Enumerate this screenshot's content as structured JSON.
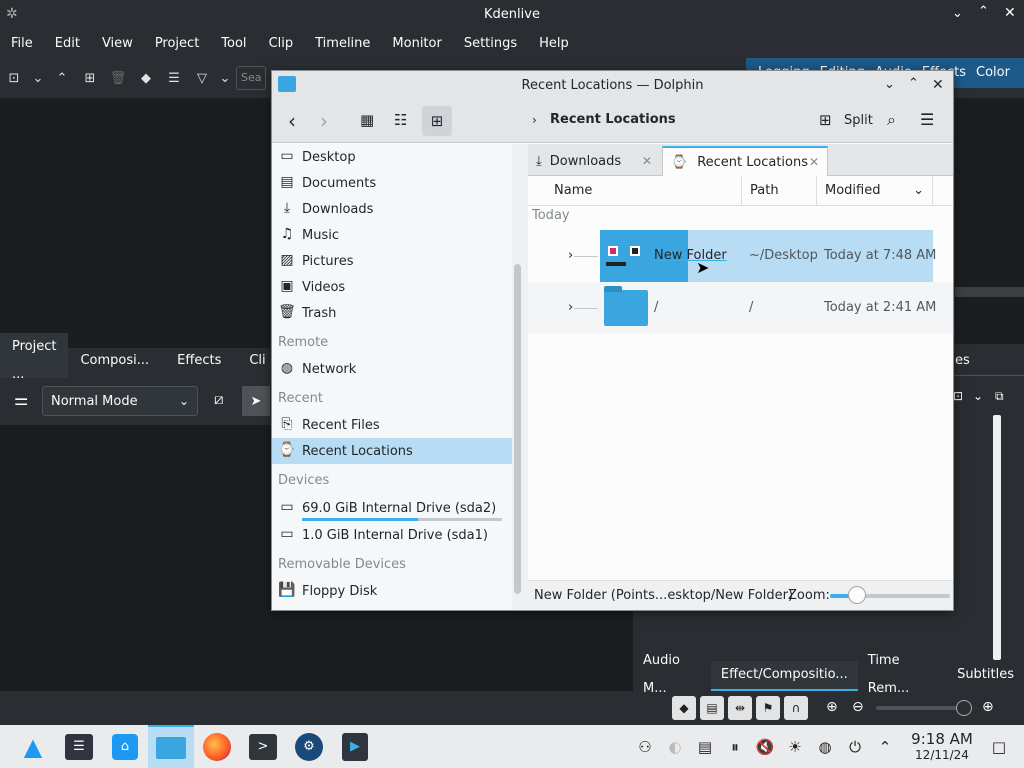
{
  "kdenlive": {
    "title": "Kdenlive",
    "menu": [
      "File",
      "Edit",
      "View",
      "Project",
      "Tool",
      "Clip",
      "Timeline",
      "Monitor",
      "Settings",
      "Help"
    ],
    "layouts": [
      "Logging",
      "Editing",
      "Audio",
      "Effects",
      "Color"
    ],
    "search_placeholder": "Sea",
    "dock_tabs": [
      "Project ...",
      "Composi...",
      "Effects",
      "Cli"
    ],
    "mode": "Normal Mode",
    "right_tab_partial": "es",
    "bottom_tabs": [
      "Audio M...",
      "Effect/Compositio...",
      "Time Rem...",
      "Subtitles"
    ]
  },
  "dolphin": {
    "title": "Recent Locations — Dolphin",
    "breadcrumb": "Recent Locations",
    "split_label": "Split",
    "tabs": [
      "Downloads",
      "Recent Locations"
    ],
    "columns": [
      "Name",
      "Path",
      "Modified"
    ],
    "group": "Today",
    "rows": [
      {
        "name": "New Folder",
        "path": "~/Desktop",
        "modified": "Today at 7:48 AM"
      },
      {
        "name": "/",
        "path": "/",
        "modified": "Today at 2:41 AM"
      }
    ],
    "status": "New Folder (Points...esktop/New Folder)",
    "zoom_label": "Zoom:",
    "zoom_level": 0.1,
    "places": {
      "items": [
        "Desktop",
        "Documents",
        "Downloads",
        "Music",
        "Pictures",
        "Videos",
        "Trash"
      ],
      "remote_header": "Remote",
      "remote": [
        "Network"
      ],
      "recent_header": "Recent",
      "recent": [
        "Recent Files",
        "Recent Locations"
      ],
      "devices_header": "Devices",
      "devices": [
        "69.0 GiB Internal Drive (sda2)",
        "1.0 GiB Internal Drive (sda1)"
      ],
      "removable_header": "Removable Devices",
      "removable": [
        "Floppy Disk"
      ]
    }
  },
  "taskbar": {
    "time": "9:18 AM",
    "date": "12/11/24"
  },
  "colors": {
    "accent": "#3daee9",
    "selection": "#b8dcf3",
    "dark_bg": "#2a2e32",
    "folder": "#3aa6df"
  }
}
